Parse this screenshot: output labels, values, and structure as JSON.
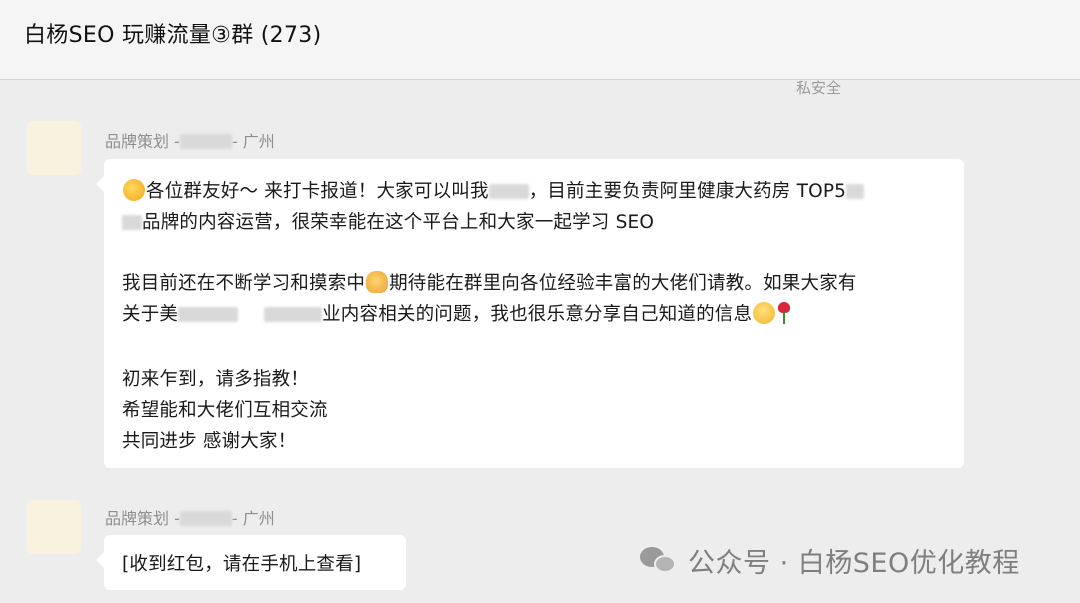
{
  "header": {
    "title": "白杨SEO 玩赚流量③群 (273)"
  },
  "partial_text": "私安全",
  "messages": [
    {
      "sender_prefix": "品牌策划 -",
      "sender_suffix": "- 广州",
      "lines": {
        "l1_a": "各位群友好～ 来打卡报道！大家可以叫我",
        "l1_b": "，目前主要负责阿里健康大药房 TOP5",
        "l2_a": "品牌的内容运营，很荣幸能在这个平台上和大家一起学习 SEO",
        "l3_a": "我目前还在不断学习和摸索中",
        "l3_b": "期待能在群里向各位经验丰富的大佬们请教。如果大家有",
        "l4_a": "关于美",
        "l4_b": "业内容相关的问题，我也很乐意分享自己知道的信息",
        "l5": "初来乍到，请多指教！",
        "l6": "希望能和大佬们互相交流",
        "l7": "共同进步 感谢大家！"
      },
      "emoji_icons": [
        "thinking-face-emoji",
        "folded-hands-emoji",
        "smiling-face-emoji",
        "rose-emoji"
      ]
    },
    {
      "sender_prefix": "品牌策划 -",
      "sender_suffix": "- 广州",
      "text": "[收到红包，请在手机上查看]"
    }
  ],
  "watermark": {
    "text": "公众号 · 白杨SEO优化教程",
    "icon": "wechat-icon"
  },
  "colors": {
    "page_bg": "#ededed",
    "header_bg": "#f5f5f5",
    "bubble_bg": "#ffffff",
    "sender_text": "#8f8f8f",
    "avatar_bg": "#f8f2df"
  }
}
